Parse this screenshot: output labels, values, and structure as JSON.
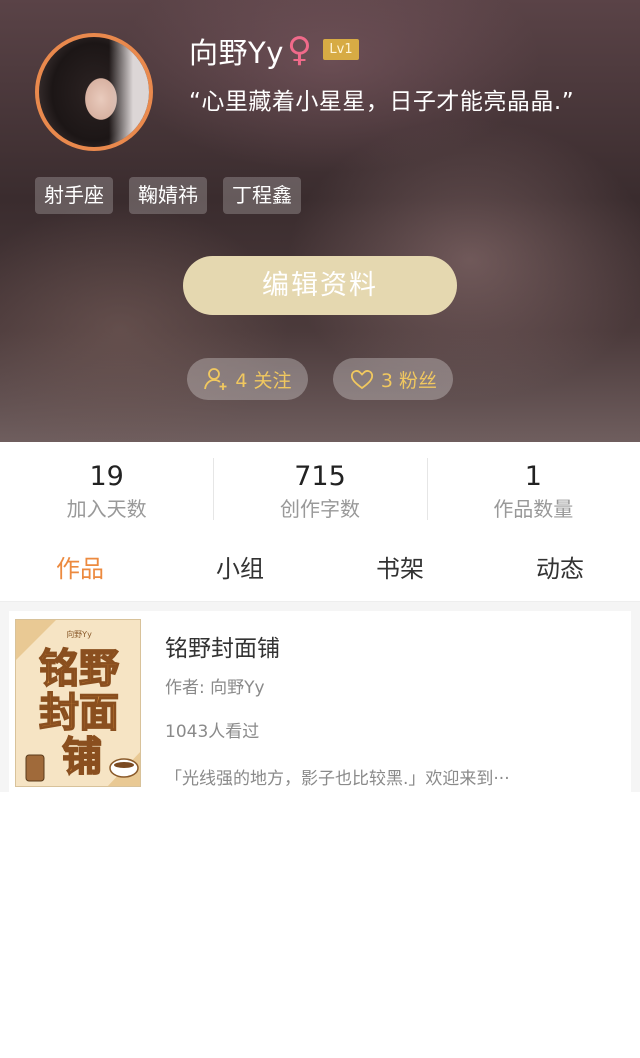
{
  "profile": {
    "username": "向野Yy",
    "gender_icon": "♀",
    "level": "Lv1",
    "signature": "“心里藏着小星星，日子才能亮晶晶.”",
    "tags": [
      "射手座",
      "鞠婧祎",
      "丁程鑫"
    ],
    "edit_label": "编辑资料",
    "following": {
      "icon": "user-add-icon",
      "label": "4 关注"
    },
    "fans": {
      "icon": "heart-icon",
      "label": "3 粉丝"
    }
  },
  "stats": [
    {
      "value": "19",
      "label": "加入天数"
    },
    {
      "value": "715",
      "label": "创作字数"
    },
    {
      "value": "1",
      "label": "作品数量"
    }
  ],
  "tabs": [
    {
      "label": "作品",
      "active": true
    },
    {
      "label": "小组",
      "active": false
    },
    {
      "label": "书架",
      "active": false
    },
    {
      "label": "动态",
      "active": false
    }
  ],
  "works": [
    {
      "title": "铭野封面铺",
      "author": "作者: 向野Yy",
      "views": "1043人看过",
      "description": "「光线强的地方，影子也比较黑.」欢迎来到···",
      "cover": {
        "credit": "向野Yy",
        "lines": [
          "铭野",
          "封面",
          "铺"
        ]
      }
    }
  ],
  "colors": {
    "accent": "#ec8a3f",
    "level_badge": "#d7ab44",
    "edit_button": "#e5d8b0",
    "pill_text": "#f1c85f",
    "gender": "#f06a8a"
  }
}
